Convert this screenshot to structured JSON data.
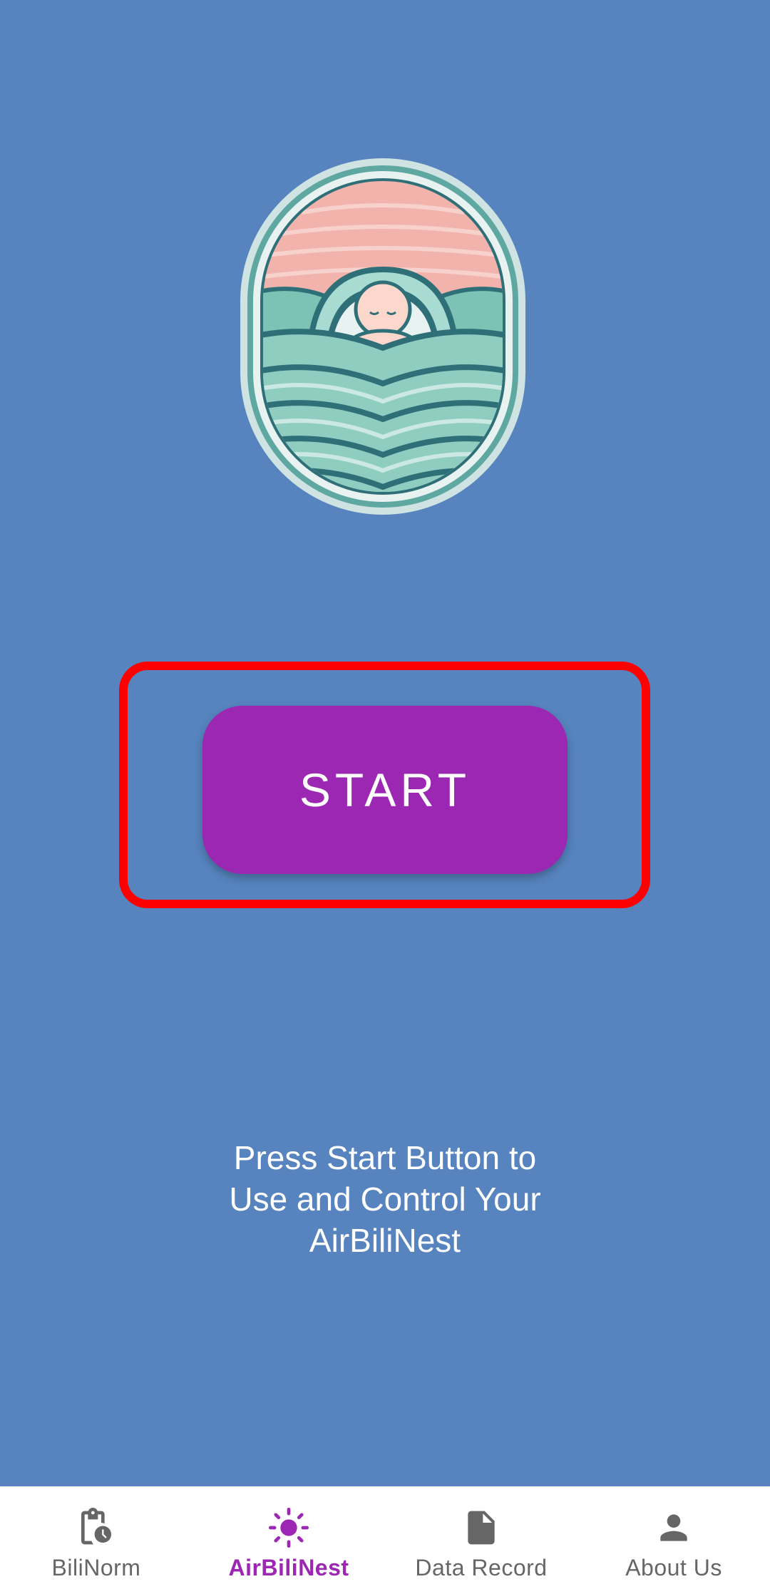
{
  "main": {
    "start_label": "START",
    "instructions": "Press Start Button to\nUse and Control Your\nAirBiliNest"
  },
  "bottom_nav": {
    "items": [
      {
        "label": "BiliNorm",
        "icon": "clipboard-clock-icon",
        "active": false
      },
      {
        "label": "AirBiliNest",
        "icon": "sun-icon",
        "active": true
      },
      {
        "label": "Data Record",
        "icon": "document-icon",
        "active": false
      },
      {
        "label": "About Us",
        "icon": "person-icon",
        "active": false
      }
    ]
  },
  "colors": {
    "background": "#5784bf",
    "accent": "#9b27b2",
    "highlight": "#ff0000",
    "nav_inactive": "#666666"
  }
}
